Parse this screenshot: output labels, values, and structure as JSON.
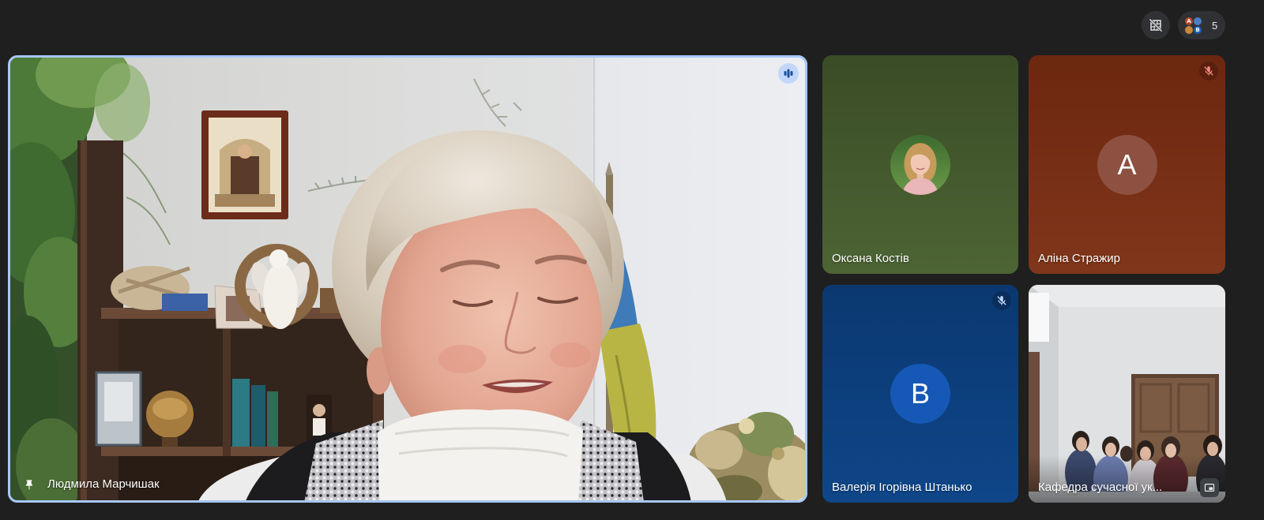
{
  "top_bar": {
    "effects_button": {
      "icon": "grid-off-icon"
    },
    "participants_button": {
      "count": "5",
      "avatars": [
        {
          "letter": "А",
          "color": "#b5472b"
        },
        {
          "letter": "",
          "color": "#4a7fc4"
        },
        {
          "letter": "",
          "color": "#c9873d"
        },
        {
          "letter": "В",
          "color": "#1a5fbf"
        }
      ]
    }
  },
  "main_tile": {
    "participant_name": "Людмила Марчишак",
    "pinned": true,
    "speaking": true,
    "pin_icon": "pin-icon",
    "speaking_icon": "audio-level-icon",
    "active_border_color": "#a8c7fa"
  },
  "tiles": [
    {
      "participant_name": "Оксана Костів",
      "background": "linear-gradient(180deg,#3a4c26,#4d6434)",
      "avatar_photo": true,
      "muted": false
    },
    {
      "participant_name": "Аліна Стражир",
      "background": "linear-gradient(180deg,#6c2710,#80361a)",
      "avatar_letter": "А",
      "avatar_color": "#8c5140",
      "muted": true,
      "mic_icon": "mic-off-icon",
      "mic_icon_color": "#f28b82"
    },
    {
      "participant_name": "Валерія Ігорівна Штанько",
      "background": "linear-gradient(180deg,#0b3870,#0e4689)",
      "avatar_letter": "В",
      "avatar_color": "#1658b5",
      "muted": true,
      "mic_icon": "mic-off-icon",
      "mic_icon_color": "#c6dafc"
    },
    {
      "participant_name": "Кафедра сучасної ук...",
      "video": true,
      "corner_icon": "picture-in-picture-icon"
    }
  ]
}
